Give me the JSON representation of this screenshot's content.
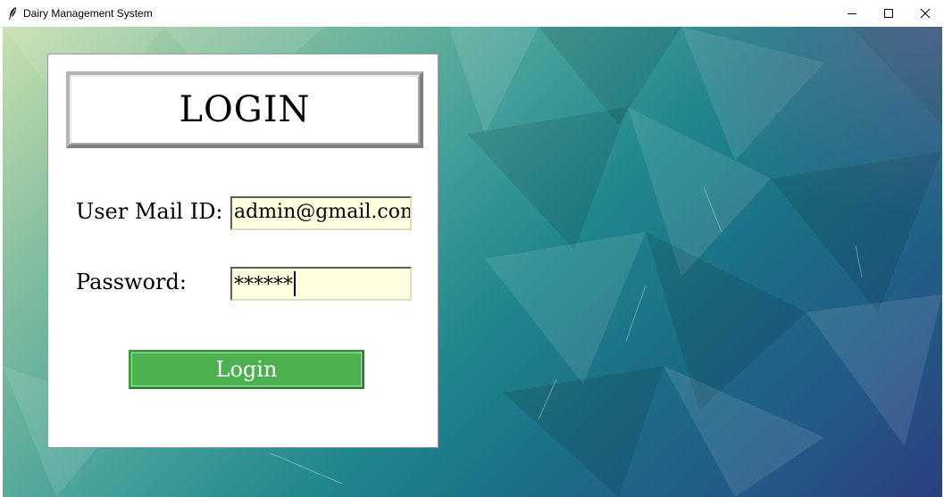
{
  "window": {
    "title": "Dairy Management System",
    "icons": {
      "app": "feather-icon",
      "minimize": "minimize-icon",
      "maximize": "maximize-icon",
      "close": "close-icon"
    }
  },
  "login": {
    "heading": "LOGIN",
    "email_label": "User Mail ID:",
    "email_value": "admin@gmail.con",
    "password_label": "Password:",
    "password_value": "******",
    "button_label": "Login"
  },
  "colors": {
    "button_bg": "#4caf50",
    "field_bg": "#ffffe0",
    "panel_bg": "#ffffff"
  }
}
